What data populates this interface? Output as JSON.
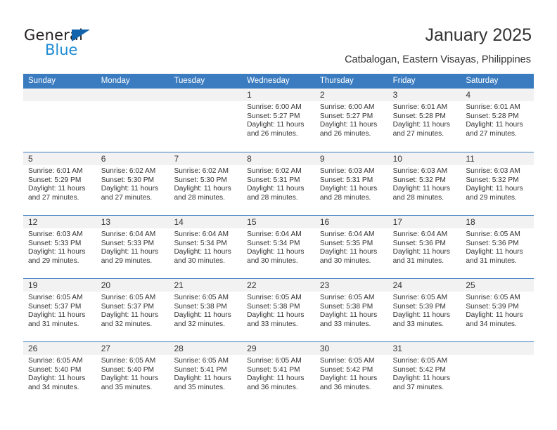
{
  "brand": {
    "name_part1": "General",
    "name_part2": "Blue",
    "accent_color": "#1e8bd4",
    "triangle_color": "#1264ad"
  },
  "header": {
    "title": "January 2025",
    "subtitle": "Catbalogan, Eastern Visayas, Philippines"
  },
  "calendar": {
    "header_color": "#3b7cc0",
    "daynum_band_color": "#f2f2f2",
    "weekday_headers": [
      "Sunday",
      "Monday",
      "Tuesday",
      "Wednesday",
      "Thursday",
      "Friday",
      "Saturday"
    ],
    "weeks": [
      [
        {
          "day": "",
          "lines": []
        },
        {
          "day": "",
          "lines": []
        },
        {
          "day": "",
          "lines": []
        },
        {
          "day": "1",
          "lines": [
            "Sunrise: 6:00 AM",
            "Sunset: 5:27 PM",
            "Daylight: 11 hours",
            "and 26 minutes."
          ]
        },
        {
          "day": "2",
          "lines": [
            "Sunrise: 6:00 AM",
            "Sunset: 5:27 PM",
            "Daylight: 11 hours",
            "and 26 minutes."
          ]
        },
        {
          "day": "3",
          "lines": [
            "Sunrise: 6:01 AM",
            "Sunset: 5:28 PM",
            "Daylight: 11 hours",
            "and 27 minutes."
          ]
        },
        {
          "day": "4",
          "lines": [
            "Sunrise: 6:01 AM",
            "Sunset: 5:28 PM",
            "Daylight: 11 hours",
            "and 27 minutes."
          ]
        }
      ],
      [
        {
          "day": "5",
          "lines": [
            "Sunrise: 6:01 AM",
            "Sunset: 5:29 PM",
            "Daylight: 11 hours",
            "and 27 minutes."
          ]
        },
        {
          "day": "6",
          "lines": [
            "Sunrise: 6:02 AM",
            "Sunset: 5:30 PM",
            "Daylight: 11 hours",
            "and 27 minutes."
          ]
        },
        {
          "day": "7",
          "lines": [
            "Sunrise: 6:02 AM",
            "Sunset: 5:30 PM",
            "Daylight: 11 hours",
            "and 28 minutes."
          ]
        },
        {
          "day": "8",
          "lines": [
            "Sunrise: 6:02 AM",
            "Sunset: 5:31 PM",
            "Daylight: 11 hours",
            "and 28 minutes."
          ]
        },
        {
          "day": "9",
          "lines": [
            "Sunrise: 6:03 AM",
            "Sunset: 5:31 PM",
            "Daylight: 11 hours",
            "and 28 minutes."
          ]
        },
        {
          "day": "10",
          "lines": [
            "Sunrise: 6:03 AM",
            "Sunset: 5:32 PM",
            "Daylight: 11 hours",
            "and 28 minutes."
          ]
        },
        {
          "day": "11",
          "lines": [
            "Sunrise: 6:03 AM",
            "Sunset: 5:32 PM",
            "Daylight: 11 hours",
            "and 29 minutes."
          ]
        }
      ],
      [
        {
          "day": "12",
          "lines": [
            "Sunrise: 6:03 AM",
            "Sunset: 5:33 PM",
            "Daylight: 11 hours",
            "and 29 minutes."
          ]
        },
        {
          "day": "13",
          "lines": [
            "Sunrise: 6:04 AM",
            "Sunset: 5:33 PM",
            "Daylight: 11 hours",
            "and 29 minutes."
          ]
        },
        {
          "day": "14",
          "lines": [
            "Sunrise: 6:04 AM",
            "Sunset: 5:34 PM",
            "Daylight: 11 hours",
            "and 30 minutes."
          ]
        },
        {
          "day": "15",
          "lines": [
            "Sunrise: 6:04 AM",
            "Sunset: 5:34 PM",
            "Daylight: 11 hours",
            "and 30 minutes."
          ]
        },
        {
          "day": "16",
          "lines": [
            "Sunrise: 6:04 AM",
            "Sunset: 5:35 PM",
            "Daylight: 11 hours",
            "and 30 minutes."
          ]
        },
        {
          "day": "17",
          "lines": [
            "Sunrise: 6:04 AM",
            "Sunset: 5:36 PM",
            "Daylight: 11 hours",
            "and 31 minutes."
          ]
        },
        {
          "day": "18",
          "lines": [
            "Sunrise: 6:05 AM",
            "Sunset: 5:36 PM",
            "Daylight: 11 hours",
            "and 31 minutes."
          ]
        }
      ],
      [
        {
          "day": "19",
          "lines": [
            "Sunrise: 6:05 AM",
            "Sunset: 5:37 PM",
            "Daylight: 11 hours",
            "and 31 minutes."
          ]
        },
        {
          "day": "20",
          "lines": [
            "Sunrise: 6:05 AM",
            "Sunset: 5:37 PM",
            "Daylight: 11 hours",
            "and 32 minutes."
          ]
        },
        {
          "day": "21",
          "lines": [
            "Sunrise: 6:05 AM",
            "Sunset: 5:38 PM",
            "Daylight: 11 hours",
            "and 32 minutes."
          ]
        },
        {
          "day": "22",
          "lines": [
            "Sunrise: 6:05 AM",
            "Sunset: 5:38 PM",
            "Daylight: 11 hours",
            "and 33 minutes."
          ]
        },
        {
          "day": "23",
          "lines": [
            "Sunrise: 6:05 AM",
            "Sunset: 5:38 PM",
            "Daylight: 11 hours",
            "and 33 minutes."
          ]
        },
        {
          "day": "24",
          "lines": [
            "Sunrise: 6:05 AM",
            "Sunset: 5:39 PM",
            "Daylight: 11 hours",
            "and 33 minutes."
          ]
        },
        {
          "day": "25",
          "lines": [
            "Sunrise: 6:05 AM",
            "Sunset: 5:39 PM",
            "Daylight: 11 hours",
            "and 34 minutes."
          ]
        }
      ],
      [
        {
          "day": "26",
          "lines": [
            "Sunrise: 6:05 AM",
            "Sunset: 5:40 PM",
            "Daylight: 11 hours",
            "and 34 minutes."
          ]
        },
        {
          "day": "27",
          "lines": [
            "Sunrise: 6:05 AM",
            "Sunset: 5:40 PM",
            "Daylight: 11 hours",
            "and 35 minutes."
          ]
        },
        {
          "day": "28",
          "lines": [
            "Sunrise: 6:05 AM",
            "Sunset: 5:41 PM",
            "Daylight: 11 hours",
            "and 35 minutes."
          ]
        },
        {
          "day": "29",
          "lines": [
            "Sunrise: 6:05 AM",
            "Sunset: 5:41 PM",
            "Daylight: 11 hours",
            "and 36 minutes."
          ]
        },
        {
          "day": "30",
          "lines": [
            "Sunrise: 6:05 AM",
            "Sunset: 5:42 PM",
            "Daylight: 11 hours",
            "and 36 minutes."
          ]
        },
        {
          "day": "31",
          "lines": [
            "Sunrise: 6:05 AM",
            "Sunset: 5:42 PM",
            "Daylight: 11 hours",
            "and 37 minutes."
          ]
        },
        {
          "day": "",
          "lines": []
        }
      ]
    ]
  }
}
